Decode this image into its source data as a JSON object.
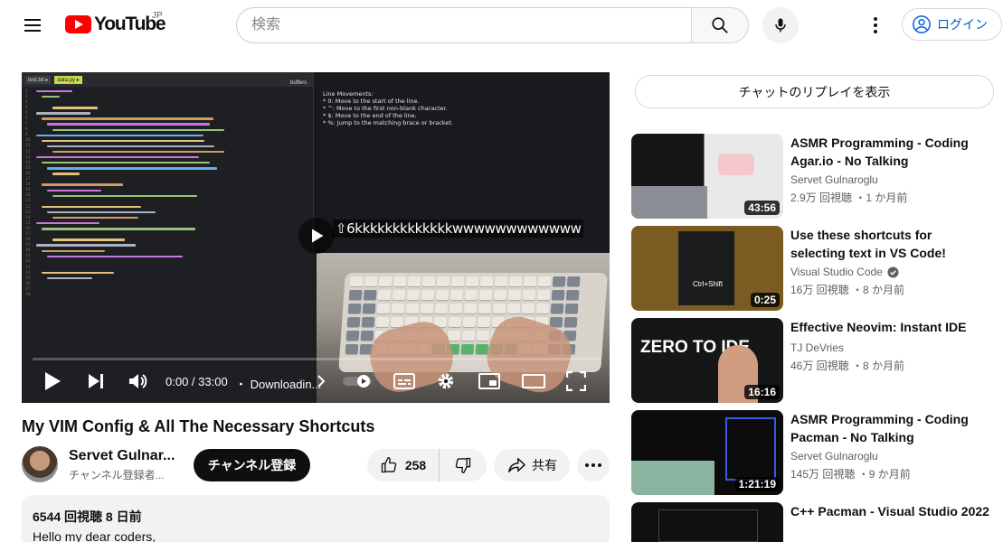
{
  "header": {
    "logo_text": "YouTube",
    "region": "JP",
    "search_placeholder": "検索",
    "login_label": "ログイン"
  },
  "player": {
    "overlay_text": "⇧6kkkkkkkkkkkkkwwwwwwwwwwww",
    "time": "0:00 / 33:00",
    "download_status": "・ Downloadin...",
    "notes_title": "buffers",
    "notes_text": "Line Movements:\n* 0: Move to the start of the line.\n* ^: Move to the first non-blank character.\n* $: Move to the end of the line.\n* %: Jump to the matching brace or bracket.",
    "code_tabs": [
      "test.txt ▸",
      "data.py ▸"
    ]
  },
  "video": {
    "title": "My VIM Config & All The Necessary Shortcuts",
    "channel_name": "Servet Gulnar...",
    "channel_subs": "チャンネル登録者...",
    "subscribe_label": "チャンネル登録",
    "like_count": "258",
    "share_label": "共有",
    "description_meta": "6544 回視聴  8 日前",
    "description_text": "Hello my dear coders,"
  },
  "sidebar": {
    "chat_replay_label": "チャットのリプレイを表示",
    "recommendations": [
      {
        "title": "ASMR Programming - Coding Agar.io - No Talking",
        "channel": "Servet Gulnaroglu",
        "verified": false,
        "meta": "2.9万 回視聴 ・1 か月前",
        "duration": "43:56"
      },
      {
        "title": "Use these shortcuts for selecting text in VS Code!",
        "channel": "Visual Studio Code",
        "verified": true,
        "meta": "16万 回視聴 ・8 か月前",
        "duration": "0:25",
        "thumb_text": "Ctrl+Shift"
      },
      {
        "title": "Effective Neovim: Instant IDE",
        "channel": "TJ DeVries",
        "verified": false,
        "meta": "46万 回視聴 ・8 か月前",
        "duration": "16:16",
        "thumb_text": "ZERO TO IDE"
      },
      {
        "title": "ASMR Programming - Coding Pacman - No Talking",
        "channel": "Servet Gulnaroglu",
        "verified": false,
        "meta": "145万 回視聴 ・9 か月前",
        "duration": "1:21:19"
      },
      {
        "title": "C++ Pacman - Visual Studio 2022",
        "channel": "",
        "verified": false,
        "meta": "",
        "duration": ""
      }
    ]
  },
  "colors": {
    "brand_red": "#ff0000",
    "link_blue": "#065fd4",
    "text_primary": "#0f0f0f",
    "text_secondary": "#606060"
  }
}
